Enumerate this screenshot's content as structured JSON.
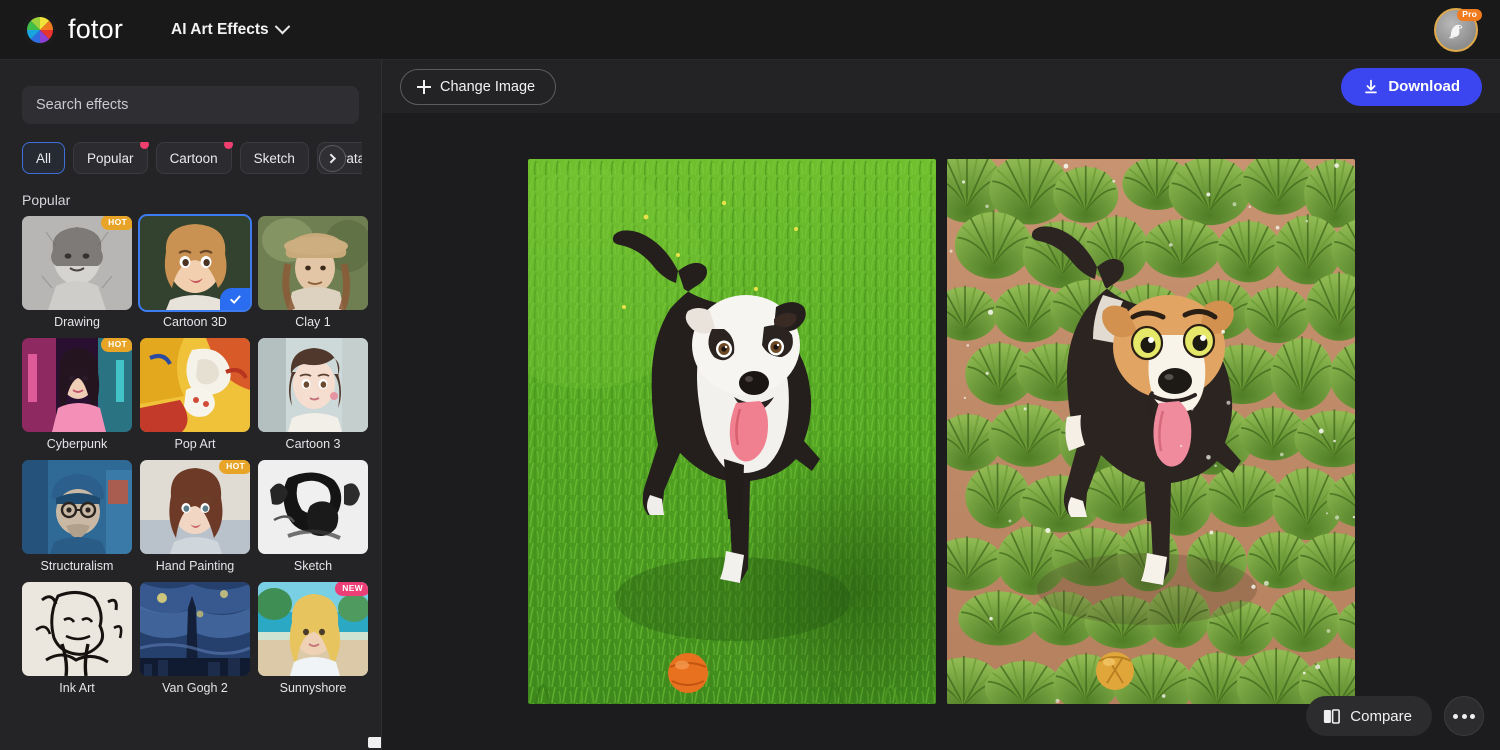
{
  "header": {
    "logo_icon": "fotor-color-wheel-icon",
    "brand": "fotor",
    "app_switcher_label": "AI Art Effects",
    "chevron_icon": "chevron-down-icon",
    "avatar_icon": "bird-avatar",
    "pro_badge": "Pro"
  },
  "sidebar": {
    "search": {
      "value": "",
      "placeholder": "Search effects",
      "icon": "search-input"
    },
    "categories": [
      {
        "label": "All",
        "active": true,
        "dot": false
      },
      {
        "label": "Popular",
        "active": false,
        "dot": true
      },
      {
        "label": "Cartoon",
        "active": false,
        "dot": true
      },
      {
        "label": "Sketch",
        "active": false,
        "dot": false
      },
      {
        "label": "Avatar",
        "active": false,
        "dot": false
      }
    ],
    "next_icon": "chevron-right-icon",
    "section_title": "Popular",
    "effects": [
      {
        "label": "Drawing",
        "badge": "HOT",
        "selected": false,
        "style": "drawing"
      },
      {
        "label": "Cartoon 3D",
        "badge": "",
        "selected": true,
        "style": "cartoon3d"
      },
      {
        "label": "Clay 1",
        "badge": "",
        "selected": false,
        "style": "clay1"
      },
      {
        "label": "Cyberpunk",
        "badge": "HOT",
        "selected": false,
        "style": "cyberpunk"
      },
      {
        "label": "Pop Art",
        "badge": "",
        "selected": false,
        "style": "popart"
      },
      {
        "label": "Cartoon 3",
        "badge": "",
        "selected": false,
        "style": "cartoon3"
      },
      {
        "label": "Structuralism",
        "badge": "",
        "selected": false,
        "style": "structuralism"
      },
      {
        "label": "Hand Painting",
        "badge": "HOT",
        "selected": false,
        "style": "handpainting"
      },
      {
        "label": "Sketch",
        "badge": "",
        "selected": false,
        "style": "sketch"
      },
      {
        "label": "Ink Art",
        "badge": "",
        "selected": false,
        "style": "inkart"
      },
      {
        "label": "Van Gogh 2",
        "badge": "",
        "selected": false,
        "style": "vangogh2"
      },
      {
        "label": "Sunnyshore",
        "badge": "NEW",
        "selected": false,
        "style": "sunnyshore"
      }
    ],
    "check_icon": "check-icon"
  },
  "toolbar": {
    "change_image_label": "Change Image",
    "change_image_icon": "plus-icon",
    "download_label": "Download",
    "download_icon": "download-icon"
  },
  "canvas": {
    "original_image": "dog-on-grass-photo",
    "result_image": "dog-on-grass-cartoon3d"
  },
  "footer": {
    "compare_label": "Compare",
    "compare_icon": "compare-split-icon",
    "more_icon": "more-dots-icon"
  },
  "colors": {
    "accent_blue": "#3b45f0",
    "select_blue": "#2a6df0",
    "hot_badge": "#e8a426",
    "new_badge": "#ec3f78",
    "dot_badge": "#ef3f6e",
    "pro_badge": "#f07c1f",
    "sidebar_bg": "#242426",
    "canvas_bg": "#1c1c1e",
    "header_bg": "#191919"
  }
}
